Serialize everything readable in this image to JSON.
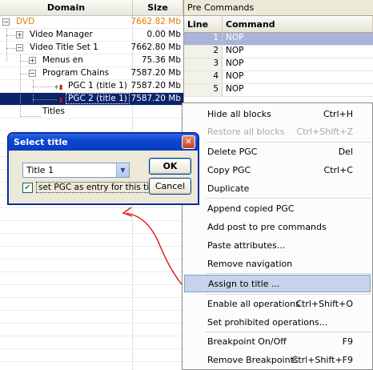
{
  "tree": {
    "col_domain": "Domain",
    "col_size": "Size",
    "rows": [
      {
        "name": "DVD",
        "size": "7662.82 Mb"
      },
      {
        "name": "Video Manager",
        "size": "0.00 Mb"
      },
      {
        "name": "Video Title Set 1",
        "size": "7662.80 Mb"
      },
      {
        "name": "Menus en",
        "size": "75.36 Mb"
      },
      {
        "name": "Program Chains",
        "size": "7587.20 Mb"
      },
      {
        "name": "PGC 1  (title 1)",
        "size": "7587.20 Mb"
      },
      {
        "name": "PGC 2  (title 1)",
        "size": "7587.20 Mb"
      },
      {
        "name": "Titles",
        "size": ""
      }
    ]
  },
  "pre_commands": {
    "title": "Pre Commands",
    "col_line": "Line",
    "col_command": "Command",
    "rows": [
      {
        "line": "1",
        "command": "NOP"
      },
      {
        "line": "2",
        "command": "NOP"
      },
      {
        "line": "3",
        "command": "NOP"
      },
      {
        "line": "4",
        "command": "NOP"
      },
      {
        "line": "5",
        "command": "NOP"
      }
    ]
  },
  "context_menu": {
    "items": [
      {
        "label": "Hide all blocks",
        "shortcut": "Ctrl+H",
        "enabled": true
      },
      {
        "label": "Restore all blocks",
        "shortcut": "Ctrl+Shift+Z",
        "enabled": false
      },
      {
        "label": "Delete PGC",
        "shortcut": "Del",
        "enabled": true
      },
      {
        "label": "Copy PGC",
        "shortcut": "Ctrl+C",
        "enabled": true
      },
      {
        "label": "Duplicate",
        "shortcut": "",
        "enabled": true
      },
      {
        "label": "Append copied PGC",
        "shortcut": "",
        "enabled": true
      },
      {
        "label": "Add post to pre commands",
        "shortcut": "",
        "enabled": true
      },
      {
        "label": "Paste attributes...",
        "shortcut": "",
        "enabled": true
      },
      {
        "label": "Remove navigation",
        "shortcut": "",
        "enabled": true
      },
      {
        "label": "Assign to title ...",
        "shortcut": "",
        "enabled": true,
        "highlighted": true
      },
      {
        "label": "Enable all operations",
        "shortcut": "Ctrl+Shift+O",
        "enabled": true
      },
      {
        "label": "Set prohibited operations...",
        "shortcut": "",
        "enabled": true
      },
      {
        "label": "Breakpoint On/Off",
        "shortcut": "F9",
        "enabled": true
      },
      {
        "label": "Remove Breakpoints",
        "shortcut": "Ctrl+Shift+F9",
        "enabled": true
      }
    ]
  },
  "dialog": {
    "title": "Select title",
    "close_glyph": "✕",
    "select_value": "Title 1",
    "checkbox_label": "set PGC as entry for this title",
    "checkbox_checked": true,
    "ok_label": "OK",
    "cancel_label": "Cancel"
  },
  "colors": {
    "accent_orange": "#e07b00",
    "selection_blue": "#0a246a",
    "annotation_arrow_red": "#e01010"
  }
}
